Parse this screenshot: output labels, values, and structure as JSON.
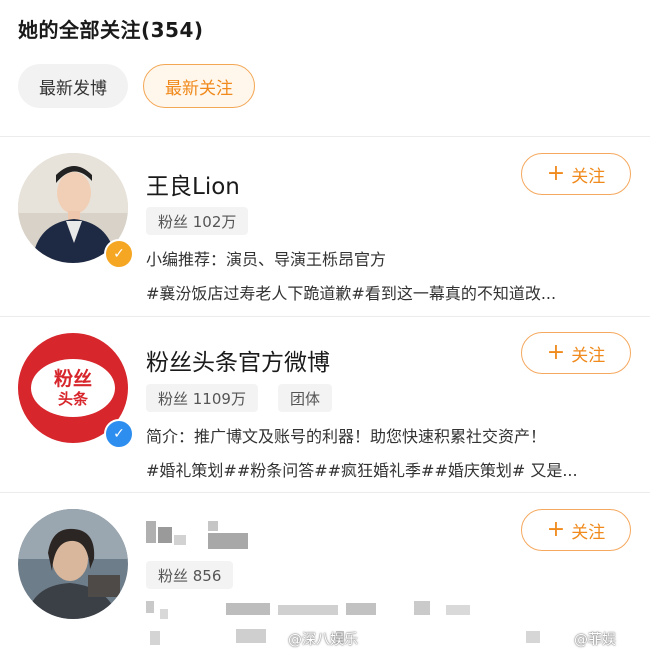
{
  "header": {
    "title": "她的全部关注(354)"
  },
  "tabs": [
    {
      "label": "最新发博",
      "active": false
    },
    {
      "label": "最新关注",
      "active": true
    }
  ],
  "accent_color": "#f08a1c",
  "verify_colors": {
    "personal": "#f5a623",
    "org": "#2d8ef0"
  },
  "users": [
    {
      "name": "王良Lion",
      "fans": "粉丝 102万",
      "desc1": "小编推荐：演员、导演王栎昂官方",
      "desc2": "#襄汾饭店过寿老人下跪道歉#看到这一幕真的不知道改...",
      "follow": "关注",
      "verify": "personal"
    },
    {
      "name": "粉丝头条官方微博",
      "fans": "粉丝 1109万",
      "tag": "团体",
      "desc1": "简介：推广博文及账号的利器！助您快速积累社交资产！",
      "desc2": "#婚礼策划##粉条问答##疯狂婚礼季##婚庆策划# 又是...",
      "follow": "关注",
      "logo_line1": "粉丝",
      "logo_line2": "头条",
      "verify": "org"
    },
    {
      "name": "",
      "fans": "粉丝 856",
      "follow": "关注"
    }
  ],
  "watermarks": [
    "@深八娱乐",
    "@菲娱"
  ]
}
